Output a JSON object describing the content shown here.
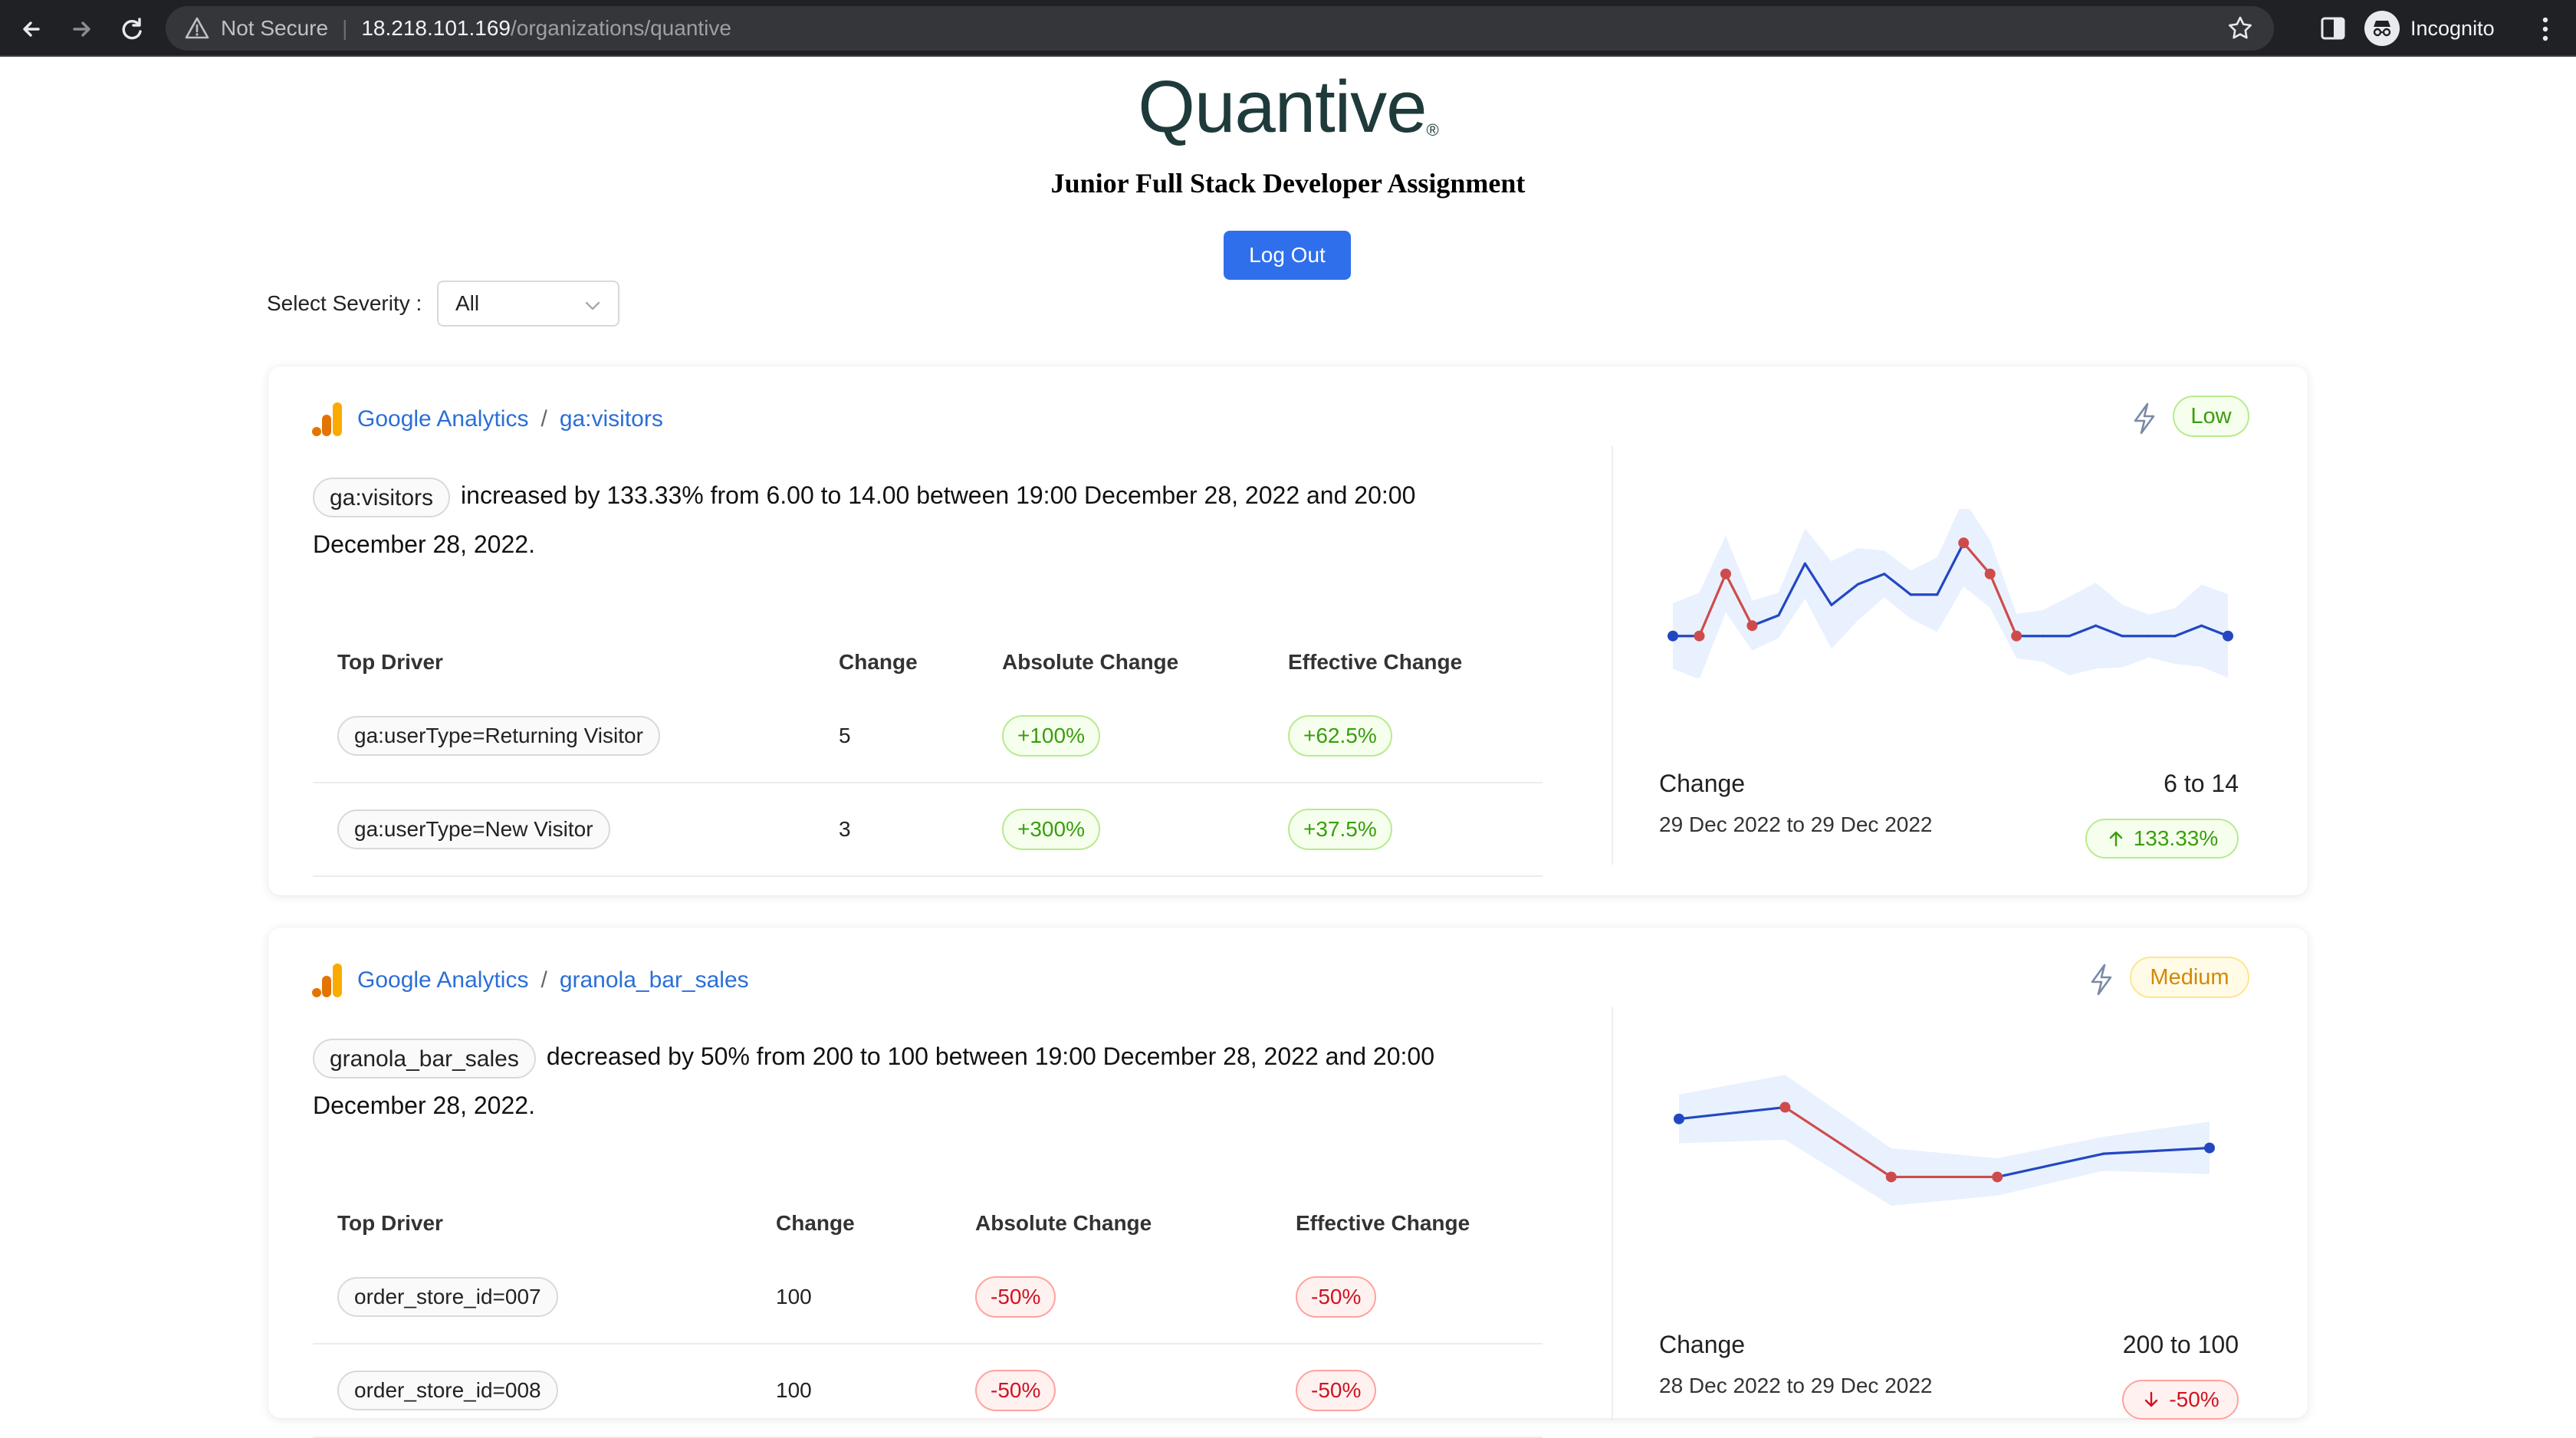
{
  "browser": {
    "security_label": "Not Secure",
    "url_host": "18.218.101.169",
    "url_path": "/organizations/quantive",
    "profile_label": "Incognito"
  },
  "header": {
    "logo_text": "Quantive",
    "logo_mark": "®",
    "subtitle": "Junior Full Stack Developer Assignment",
    "logout_label": "Log Out"
  },
  "filter": {
    "label": "Select Severity :",
    "selected": "All"
  },
  "columns": {
    "driver": "Top Driver",
    "change": "Change",
    "absolute": "Absolute Change",
    "effective": "Effective Change"
  },
  "cards": [
    {
      "source": "Google Analytics",
      "separator": "/",
      "metric": "ga:visitors",
      "severity": "Low",
      "metric_chip": "ga:visitors",
      "description": "increased by 133.33% from 6.00 to 14.00 between 19:00 December 28, 2022 and 20:00 December 28, 2022.",
      "drivers": [
        {
          "driver": "ga:userType=Returning Visitor",
          "change": "5",
          "absolute": "+100%",
          "effective": "+62.5%"
        },
        {
          "driver": "ga:userType=New Visitor",
          "change": "3",
          "absolute": "+300%",
          "effective": "+37.5%"
        }
      ],
      "summary": {
        "label": "Change",
        "range": "29 Dec 2022 to 29 Dec 2022",
        "value": "6 to 14",
        "percent": "133.33%",
        "direction": "up"
      },
      "chart_data": {
        "type": "line",
        "values": [
          6,
          6,
          12,
          7,
          8,
          13,
          9,
          11,
          12,
          10,
          10,
          15,
          12,
          6,
          6,
          6,
          7,
          6,
          6,
          6,
          7,
          6
        ],
        "anomaly_indices": [
          1,
          2,
          3,
          11,
          12,
          13
        ],
        "band": true,
        "colors": {
          "normal": "#2347c2",
          "anomaly": "#cf4b4b",
          "band": "#e8f1fd"
        }
      }
    },
    {
      "source": "Google Analytics",
      "separator": "/",
      "metric": "granola_bar_sales",
      "severity": "Medium",
      "metric_chip": "granola_bar_sales",
      "description": "decreased by 50% from 200 to 100 between 19:00 December 28, 2022 and 20:00 December 28, 2022.",
      "drivers": [
        {
          "driver": "order_store_id=007",
          "change": "100",
          "absolute": "-50%",
          "effective": "-50%"
        },
        {
          "driver": "order_store_id=008",
          "change": "100",
          "absolute": "-50%",
          "effective": "-50%"
        }
      ],
      "summary": {
        "label": "Change",
        "range": "28 Dec 2022 to 29 Dec 2022",
        "value": "200 to 100",
        "percent": "-50%",
        "direction": "down"
      },
      "chart_data": {
        "type": "line",
        "values": [
          200,
          210,
          150,
          150,
          170,
          175
        ],
        "anomaly_indices": [
          1,
          2,
          3
        ],
        "band": true,
        "colors": {
          "normal": "#2347c2",
          "anomaly": "#cf4b4b",
          "band": "#e8f1fd"
        }
      }
    }
  ]
}
